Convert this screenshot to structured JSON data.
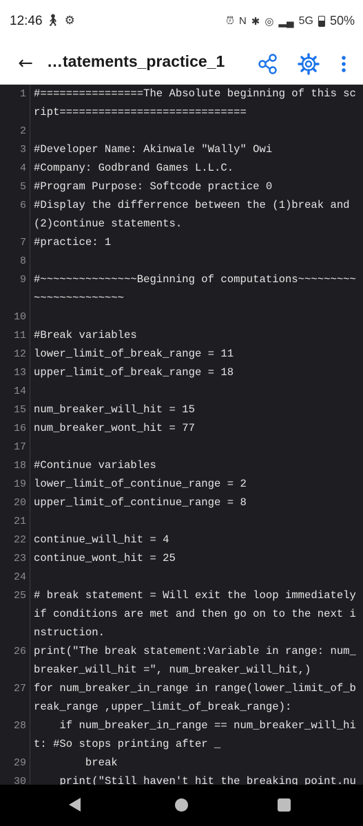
{
  "status_bar": {
    "time": "12:46",
    "left_icons": [
      "accessibility-icon",
      "gear-icon"
    ],
    "right_icons": [
      "alarm-icon",
      "nfc-icon",
      "bluetooth-icon",
      "hotspot-icon",
      "signal-icon"
    ],
    "network": "5G",
    "battery": "50%"
  },
  "app_bar": {
    "title": "…tatements_practice_1",
    "actions": [
      "share-icon",
      "gear-icon",
      "more-vert-icon"
    ]
  },
  "code_lines": [
    {
      "n": "1",
      "text": "#================The Absolute beginning of this script============================="
    },
    {
      "n": "2",
      "text": ""
    },
    {
      "n": "3",
      "text": "#Developer Name: Akinwale \"Wally\" Owi"
    },
    {
      "n": "4",
      "text": "#Company: Godbrand Games L.L.C."
    },
    {
      "n": "5",
      "text": "#Program Purpose: Softcode practice 0"
    },
    {
      "n": "6",
      "text": "#Display the differrence between the (1)break and (2)continue statements."
    },
    {
      "n": "7",
      "text": "#practice: 1"
    },
    {
      "n": "8",
      "text": ""
    },
    {
      "n": "9",
      "text": "#~~~~~~~~~~~~~~~Beginning of computations~~~~~~~~~~~~~~~~~~~~~~~"
    },
    {
      "n": "10",
      "text": ""
    },
    {
      "n": "11",
      "text": "#Break variables"
    },
    {
      "n": "12",
      "text": "lower_limit_of_break_range = 11"
    },
    {
      "n": "13",
      "text": "upper_limit_of_break_range = 18"
    },
    {
      "n": "14",
      "text": ""
    },
    {
      "n": "15",
      "text": "num_breaker_will_hit = 15"
    },
    {
      "n": "16",
      "text": "num_breaker_wont_hit = 77"
    },
    {
      "n": "17",
      "text": ""
    },
    {
      "n": "18",
      "text": "#Continue variables"
    },
    {
      "n": "19",
      "text": "lower_limit_of_continue_range = 2"
    },
    {
      "n": "20",
      "text": "upper_limit_of_continue_range = 8"
    },
    {
      "n": "21",
      "text": ""
    },
    {
      "n": "22",
      "text": "continue_will_hit = 4"
    },
    {
      "n": "23",
      "text": "continue_wont_hit = 25"
    },
    {
      "n": "24",
      "text": ""
    },
    {
      "n": "25",
      "text": "# break statement = Will exit the loop immediately if conditions are met and then go on to the next instruction."
    },
    {
      "n": "26",
      "text": "print(\"The break statement:Variable in range: num_breaker_will_hit =\", num_breaker_will_hit,)"
    },
    {
      "n": "27",
      "text": "for num_breaker_in_range in range(lower_limit_of_break_range ,upper_limit_of_break_range):"
    },
    {
      "n": "28",
      "text": "    if num_breaker_in_range == num_breaker_will_hit: #So stops printing after _"
    },
    {
      "n": "29",
      "text": "        break"
    },
    {
      "n": "30",
      "text": "    print(\"Still haven't hit the breaking point.nu"
    }
  ],
  "colors": {
    "editor_bg": "#1e1e22",
    "code_text": "#e6e6e6",
    "line_number": "#8d8d93",
    "accent": "#1a73e8",
    "nav_bg": "#000000"
  }
}
